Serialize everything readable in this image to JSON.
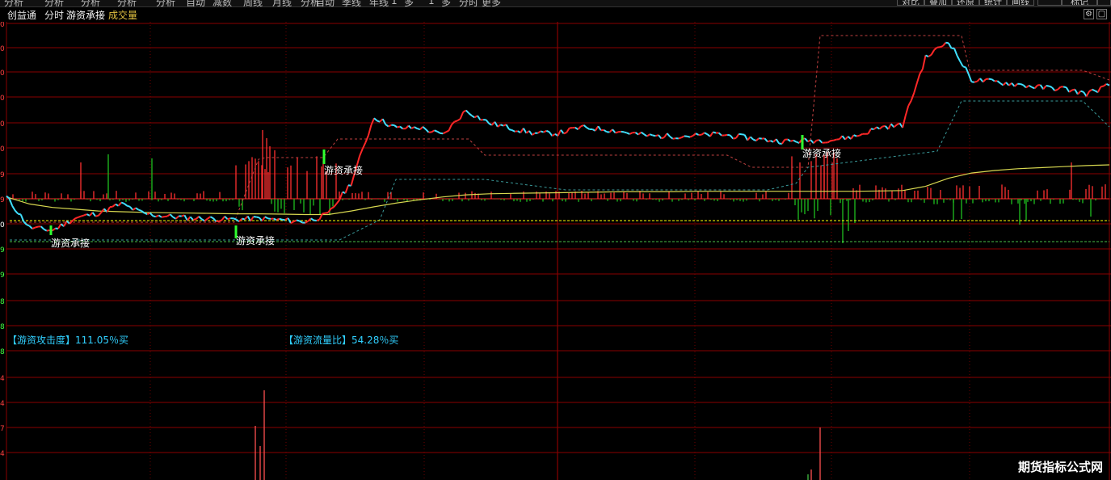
{
  "menu": {
    "items": [
      "分析",
      "分析",
      "分析",
      "分析",
      "分析",
      "自动",
      "减数",
      "周线",
      "月线",
      "分析",
      "自动",
      "季线",
      "年线",
      "1",
      "多",
      "1",
      "多",
      "分时",
      "更多"
    ],
    "right_buttons": [
      "对比",
      "叠加",
      "还原",
      "统计",
      "画线",
      "",
      "标记",
      ""
    ]
  },
  "title": {
    "product": "创益通",
    "period": "分时",
    "indicator": "游资承接",
    "sub": "成交量"
  },
  "window_icons": [
    "gear-icon",
    "restore-icon",
    "close-icon"
  ],
  "colors": {
    "background": "#000000",
    "grid": "#8a0000",
    "price_up": "#ff2828",
    "price_down": "#40e0ff",
    "avg_line": "#d8d850",
    "dashed_upper": "#c04040",
    "dashed_lower": "#3a9a9a",
    "vol_up": "#ff3030",
    "vol_down": "#20c020",
    "signal": "#ffff00",
    "info_text": "#30d0ff"
  },
  "annotations": {
    "label_1": "游资承接",
    "label_2": "游资承接",
    "label_3": "游资承接",
    "label_4": "游资承接",
    "attack_text": "【游资攻击度】111.05％买",
    "flow_text": "【游资流量比】54.28％买"
  },
  "axis_ticks": [
    "0",
    "0",
    "0",
    "0",
    "0",
    "0",
    "9",
    "9",
    "0",
    "9",
    "9",
    "8",
    "8",
    "8",
    "4",
    "4",
    "7",
    "4"
  ],
  "watermark": "期货指标公式网",
  "chart_data": {
    "type": "line",
    "x": [
      0,
      5,
      10,
      15,
      20,
      25,
      30,
      35,
      40,
      45,
      50,
      55,
      60,
      65,
      70,
      75,
      80,
      85,
      90,
      95,
      100,
      105,
      110,
      115,
      120,
      125,
      130,
      135,
      140,
      145,
      150,
      155,
      160,
      165,
      170,
      175,
      180,
      185,
      190,
      195,
      200,
      205,
      210,
      215,
      220,
      225,
      230,
      235,
      240
    ],
    "series": [
      {
        "values": [
          55.0,
          46.3,
          45.5,
          49.0,
          50.4,
          53.0,
          50.2,
          49.5,
          49.0,
          48.8,
          48.6,
          48.9,
          48.4,
          48.0,
          50.0,
          59.0,
          77.7,
          74.5,
          74.7,
          72.5,
          79.6,
          76.0,
          74.5,
          73.0,
          73.1,
          74.7,
          74.3,
          73.3,
          72.3,
          72.3,
          72.4,
          72.8,
          72.0,
          71.2,
          70.8,
          71.0,
          71.3,
          72.3,
          74.8,
          75.4,
          94.5,
          99.4,
          88.3,
          87.7,
          87.0,
          86.1,
          85.8,
          84.3,
          86.7
        ]
      },
      {
        "values": [
          55.0,
          53.0,
          52.0,
          51.5,
          51.0,
          50.8,
          50.6,
          50.5,
          50.4,
          50.3,
          50.2,
          50.2,
          50.1,
          50.0,
          50.0,
          51.0,
          52.2,
          53.3,
          54.2,
          55.0,
          55.6,
          55.9,
          56.0,
          56.1,
          56.2,
          56.3,
          56.4,
          56.5,
          56.5,
          56.5,
          56.6,
          56.6,
          56.6,
          56.6,
          56.6,
          56.6,
          56.6,
          56.6,
          56.7,
          56.8,
          58.0,
          60.3,
          61.8,
          62.5,
          63.0,
          63.3,
          63.6,
          63.9,
          64.1
        ]
      }
    ],
    "volume": {
      "up": [
        10.0,
        35.0,
        30.0,
        45.0,
        80.0,
        35.0
      ],
      "down": [
        40.0,
        25.0,
        8.0,
        8.0,
        60.0,
        45.0,
        45.0
      ]
    },
    "ylim": [
      40,
      102
    ]
  }
}
